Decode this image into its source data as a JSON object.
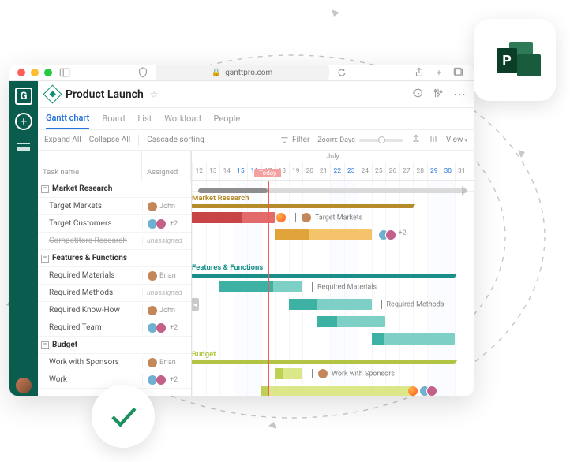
{
  "browser": {
    "url": "ganttpro.com",
    "lock_icon": "lock-icon",
    "buttons": {
      "sidebar": "sidebar-icon",
      "shield": "shield-icon",
      "reload": "reload-icon",
      "share": "share-icon",
      "plus": "plus-icon",
      "tabs": "tabs-icon"
    }
  },
  "siderail": {
    "logo": "G",
    "add": "+"
  },
  "project": {
    "title": "Product Launch"
  },
  "tabs": [
    {
      "id": "gantt",
      "label": "Gantt chart",
      "active": true
    },
    {
      "id": "board",
      "label": "Board",
      "active": false
    },
    {
      "id": "list",
      "label": "List",
      "active": false
    },
    {
      "id": "workload",
      "label": "Workload",
      "active": false
    },
    {
      "id": "people",
      "label": "People",
      "active": false
    }
  ],
  "toolbar": {
    "expand": "Expand All",
    "collapse": "Collapse All",
    "cascade": "Cascade sorting",
    "filter": "Filter",
    "zoom_label": "Zoom:",
    "zoom_value": "Days",
    "view": "View"
  },
  "grid": {
    "columns": {
      "name": "Task name",
      "assigned": "Assigned"
    }
  },
  "calendar": {
    "month": "July",
    "days": [
      12,
      13,
      14,
      15,
      16,
      17,
      18,
      19,
      20,
      21,
      22,
      23,
      24,
      25,
      26,
      27,
      28,
      29,
      30,
      31
    ],
    "weekend_days": [
      15,
      16,
      22,
      23,
      29,
      30
    ],
    "today_label": "Today",
    "today_day": 17
  },
  "tasks": [
    {
      "type": "group",
      "name": "Market Research",
      "bar": {
        "label": "Market Research",
        "color": "#b68b2a",
        "start": 12,
        "end": 28
      }
    },
    {
      "type": "task",
      "name": "Target Markets",
      "assigned": {
        "type": "single",
        "label": "John"
      },
      "bar": {
        "fill": "#e26a6a",
        "prog": "#c74545",
        "start": 12,
        "end": 18,
        "progress": 0.6,
        "label": "Target Markets",
        "flame": true,
        "label_avatar": true
      }
    },
    {
      "type": "task",
      "name": "Target Customers",
      "assigned": {
        "type": "multi",
        "extra": "+2"
      },
      "bar": {
        "fill": "#f4c36a",
        "prog": "#e0a43a",
        "start": 18,
        "end": 25,
        "progress": 0.35,
        "trail_avatars": true,
        "trail_extra": "+2"
      }
    },
    {
      "type": "task",
      "name": "Competitors Research",
      "strike": true,
      "assigned": {
        "type": "unassigned",
        "label": "unassigned"
      },
      "bar": null
    },
    {
      "type": "group",
      "name": "Features & Functions",
      "bar": {
        "label": "Features & Functions",
        "color": "#1a8f8a",
        "start": 12,
        "end": 31
      }
    },
    {
      "type": "task",
      "name": "Required Materials",
      "assigned": {
        "type": "single",
        "label": "Brian"
      },
      "bar": {
        "fill": "#7ed0c6",
        "prog": "#3db1a3",
        "start": 14,
        "end": 20,
        "progress": 0.65,
        "label": "Required Materials"
      }
    },
    {
      "type": "task",
      "name": "Required Methods",
      "assigned": {
        "type": "unassigned",
        "label": "unassigned"
      },
      "bar": {
        "fill": "#7ed0c6",
        "prog": "#3db1a3",
        "start": 19,
        "end": 25,
        "progress": 0.35,
        "label": "Required Methods"
      }
    },
    {
      "type": "task",
      "name": "Required Know-How",
      "assigned": {
        "type": "single",
        "label": "John"
      },
      "bar": {
        "fill": "#7ed0c6",
        "prog": "#3db1a3",
        "start": 21,
        "end": 26,
        "progress": 0.3
      }
    },
    {
      "type": "task",
      "name": "Required Team",
      "assigned": {
        "type": "multi",
        "extra": "+2"
      },
      "bar": {
        "fill": "#7ed0c6",
        "prog": "#3db1a3",
        "start": 25,
        "end": 31,
        "progress": 0.15
      }
    },
    {
      "type": "group",
      "name": "Budget",
      "bar": {
        "label": "Budget",
        "color": "#b3c445",
        "start": 12,
        "end": 31
      }
    },
    {
      "type": "task",
      "name": "Work with Sponsors",
      "assigned": {
        "type": "single",
        "label": "Brian"
      },
      "bar": {
        "fill": "#dce78a",
        "prog": "#c0d054",
        "start": 18,
        "end": 20,
        "progress": 0.3,
        "label": "Work with Sponsors",
        "label_avatar_sm": true
      }
    },
    {
      "type": "task",
      "name": "Work",
      "assigned": {
        "type": "multi",
        "extra": "+2"
      },
      "bar": {
        "fill": "#dce78a",
        "prog": "#c0d054",
        "start": 17,
        "end": 28,
        "progress": 0.05,
        "flame_end": true,
        "trail_avatars": true
      }
    }
  ],
  "badges": {
    "p_letter": "P"
  }
}
